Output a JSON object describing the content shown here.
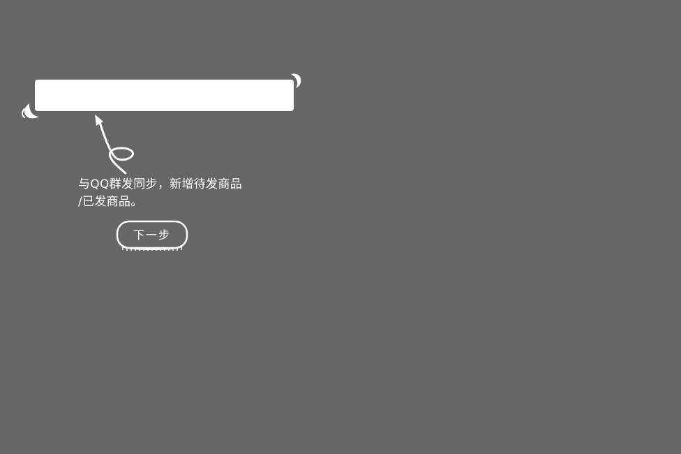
{
  "guide": {
    "tip_line1": "与QQ群发同步，新增待发商品",
    "tip_line2": "/已发商品。",
    "next_label": "下一步"
  },
  "colors": {
    "overlay": "#666666",
    "highlight": "#ffffff",
    "text": "#ffffff"
  },
  "icons": {
    "arrow": "curly-arrow-icon",
    "corner_left": "swoosh-left-icon",
    "corner_right": "swoosh-right-icon"
  }
}
